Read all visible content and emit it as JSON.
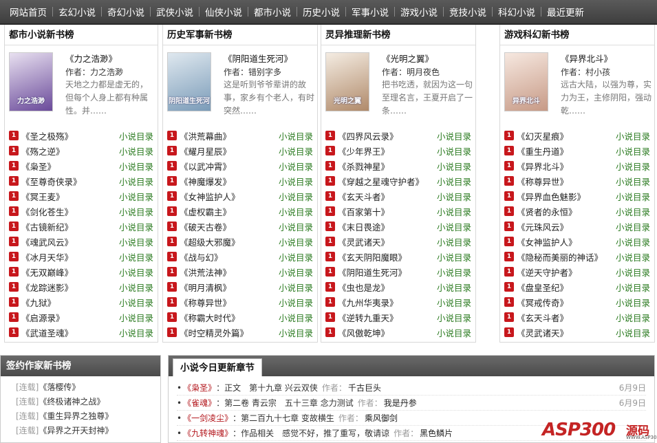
{
  "nav": [
    "网站首页",
    "玄幻小说",
    "奇幻小说",
    "武侠小说",
    "仙侠小说",
    "都市小说",
    "历史小说",
    "军事小说",
    "游戏小说",
    "竞技小说",
    "科幻小说",
    "最近更新"
  ],
  "dir_label": "小说目录",
  "badge": "1",
  "panels": [
    {
      "title": "都市小说新书榜",
      "feat": {
        "title": "《力之浩渺》",
        "author": "作者：力之浩渺",
        "desc": "天地之力都是虚无的，但每个人身上都有种属性。并……",
        "cover_text": "力之浩渺"
      },
      "books": [
        "《圣之极殇》",
        "《殇之逆》",
        "《枭圣》",
        "《至尊奇侠录》",
        "《冥王麦》",
        "《剑化苍生》",
        "《古镜新纪》",
        "《魂武风云》",
        "《冰月天华》",
        "《无双巅峰》",
        "《龙踪迷影》",
        "《九狱》",
        "《启源录》",
        "《武道圣魂》"
      ]
    },
    {
      "title": "历史军事新书榜",
      "feat": {
        "title": "《阴阳道生死河》",
        "author": "作者：错别字多",
        "desc": "这是听到爷爷辈讲的故事，家乡有个老人，有时突然……",
        "cover_text": "阴阳道生死河"
      },
      "books": [
        "《洪荒幕曲》",
        "《耀月星辰》",
        "《以武冲霄》",
        "《神魔爆发》",
        "《女神监护人》",
        "《虚权霸主》",
        "《破天古卷》",
        "《超级大邪魔》",
        "《战与幻》",
        "《洪荒法神》",
        "《明月清枫》",
        "《称尊异世》",
        "《称霸大时代》",
        "《时空精灵外篇》"
      ]
    },
    {
      "title": "灵异推理新书榜",
      "feat": {
        "title": "《光明之翼》",
        "author": "作者：明月夜色",
        "desc": "把书吃透，就因为这一句至理名言，王夏开启了一条……",
        "cover_text": "光明之翼"
      },
      "books": [
        "《四界风云录》",
        "《少年界王》",
        "《杀戮神星》",
        "《穿越之星魂守护者》",
        "《玄天斗者》",
        "《百家第十》",
        "《末日畏途》",
        "《灵武诸天》",
        "《玄天阴阳魔眼》",
        "《阴阳道生死河》",
        "《虫也是龙》",
        "《九州华夷录》",
        "《逆转九重天》",
        "《风傲乾坤》"
      ]
    },
    {
      "title": "游戏科幻新书榜",
      "feat": {
        "title": "《异界北斗》",
        "author": "作者：村小孩",
        "desc": "远古大陆，以强为尊，实力为王，主修阴阳，强动乾……",
        "cover_text": "异界北斗"
      },
      "books": [
        "《幻灭星痕》",
        "《重生丹道》",
        "《异界北斗》",
        "《称尊异世》",
        "《异界血色魅影》",
        "《贤者的永恒》",
        "《元珠风云》",
        "《女神监护人》",
        "《隐秘而美丽的神话》",
        "《逆天守护者》",
        "《盘皇圣纪》",
        "《冥戒传奇》",
        "《玄天斗者》",
        "《灵武诸天》"
      ]
    }
  ],
  "signed": {
    "title": "签约作家新书榜",
    "tag": "[连载]",
    "items": [
      "《落樱传》",
      "《终极诸神之战》",
      "《重生异界之独尊》",
      "《异界之开天封神》"
    ]
  },
  "updates": {
    "title": "小说今日更新章节",
    "author_label": "作者：",
    "items": [
      {
        "book": "《枭圣》",
        "chapter": "：正文　第十九章 兴云双侠",
        "author": "千古巨头",
        "date": "6月9日"
      },
      {
        "book": "《雀魂》",
        "chapter": "：第二卷 青云宗　五十三章 念力测试",
        "author": "我是丹参",
        "date": "6月9日"
      },
      {
        "book": "《一剑凌尘》",
        "chapter": "：第二百九十七章 变故横生",
        "author": "乘风御剑",
        "date": ""
      },
      {
        "book": "《九转神魂》",
        "chapter": "：作品相关　感觉不好，推了重写，敬请谅",
        "author": "黑色鳞片",
        "date": ""
      }
    ]
  },
  "logo": {
    "main": "ASP300",
    "side": "源码",
    "sub": "WWW.ASP300.COM"
  }
}
